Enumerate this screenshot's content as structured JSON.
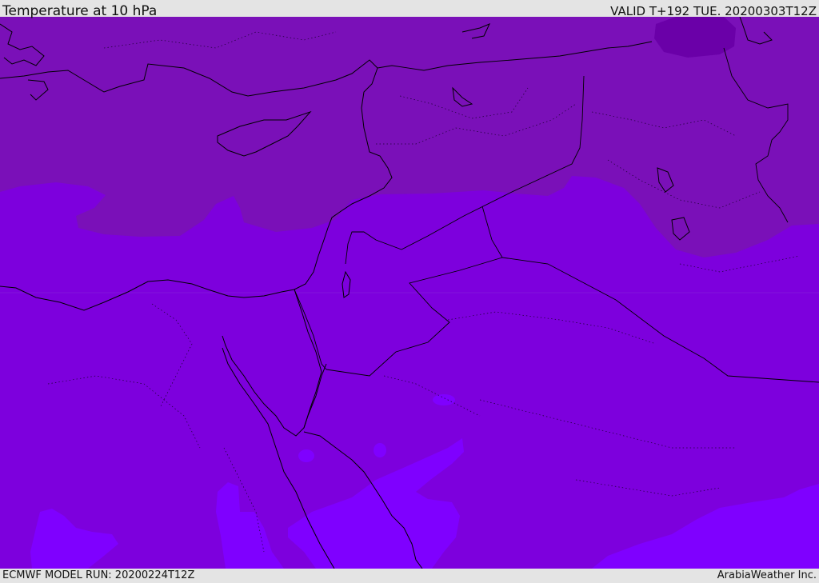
{
  "header": {
    "title": "Temperature at 10 hPa",
    "valid": "VALID T+192 TUE. 20200303T12Z"
  },
  "footer": {
    "model_run": "ECMWF MODEL RUN: 20200224T12Z",
    "credit": "ArabiaWeather Inc."
  },
  "colors": {
    "warm_band": "#7a10b8",
    "mid_band": "#7d00dd",
    "cool_band": "#7f00ff",
    "cold_spot": "#6a00a8",
    "coastline": "#000000",
    "background": "#e4e4e4"
  }
}
